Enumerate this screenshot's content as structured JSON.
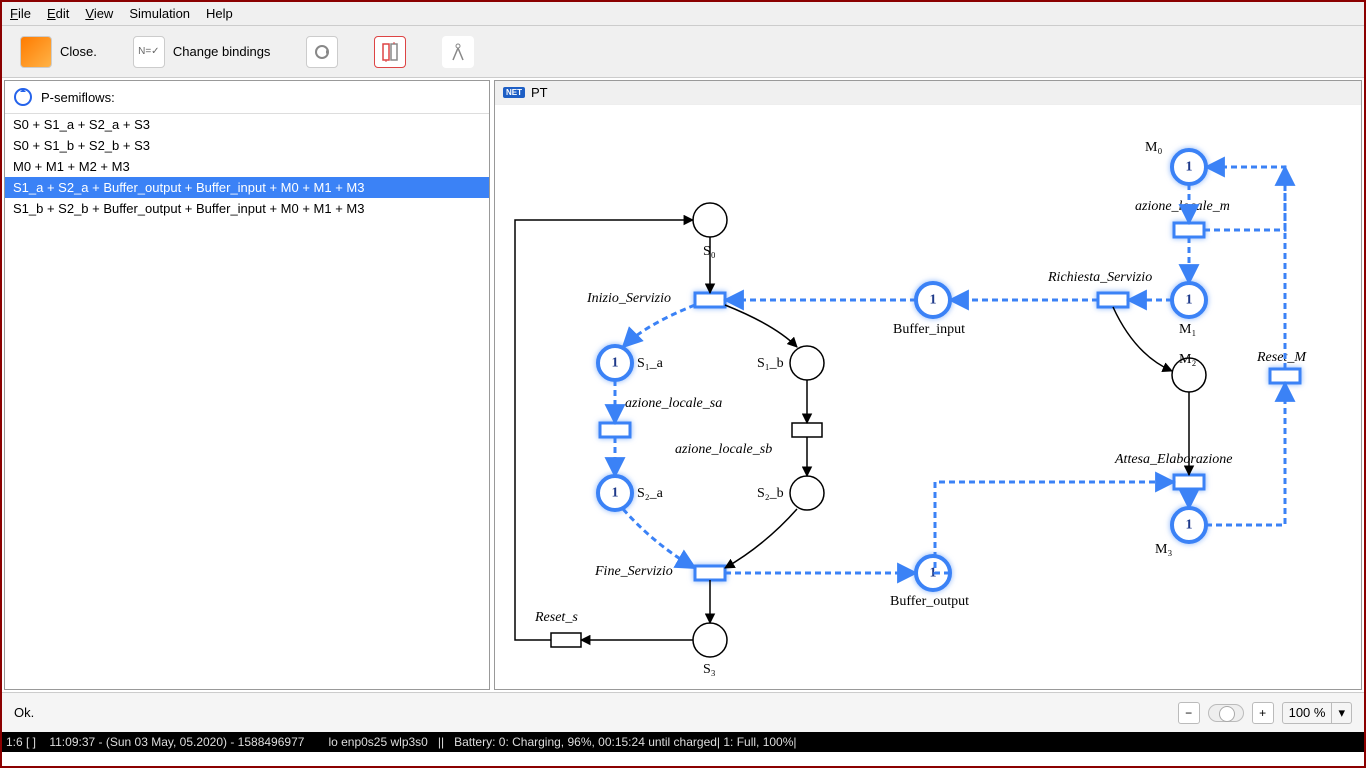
{
  "menu": {
    "file": "File",
    "edit": "Edit",
    "view": "View",
    "simulation": "Simulation",
    "help": "Help"
  },
  "toolbar": {
    "close": "Close.",
    "change_bindings": "Change bindings"
  },
  "left_panel": {
    "title": "P-semiflows:",
    "items": [
      "S0 + S1_a + S2_a + S3",
      "S0 + S1_b + S2_b + S3",
      "M0 + M1 + M2 + M3",
      "S1_a + S2_a + Buffer_output + Buffer_input + M0 + M1 + M3",
      "S1_b + S2_b + Buffer_output + Buffer_input + M0 + M1 + M3"
    ],
    "selected_index": 3
  },
  "net": {
    "title": "PT",
    "places": {
      "S0": {
        "label": "S₀",
        "hl": false
      },
      "S1_a": {
        "label": "S₁_a",
        "hl": true,
        "token": "1"
      },
      "S1_b": {
        "label": "S₁_b",
        "hl": false
      },
      "S2_a": {
        "label": "S₂_a",
        "hl": true,
        "token": "1"
      },
      "S2_b": {
        "label": "S₂_b",
        "hl": false
      },
      "S3": {
        "label": "S₃",
        "hl": false
      },
      "Buffer_input": {
        "label": "Buffer_input",
        "hl": true,
        "token": "1"
      },
      "Buffer_output": {
        "label": "Buffer_output",
        "hl": true,
        "token": "1"
      },
      "M0": {
        "label": "M₀",
        "hl": true,
        "token": "1"
      },
      "M1": {
        "label": "M₁",
        "hl": true,
        "token": "1"
      },
      "M2": {
        "label": "M₂",
        "hl": false
      },
      "M3": {
        "label": "M₃",
        "hl": true,
        "token": "1"
      }
    },
    "transitions": {
      "Inizio_Servizio": {
        "label": "Inizio_Servizio",
        "hl": true
      },
      "azione_locale_sa": {
        "label": "azione_locale_sa",
        "hl": true
      },
      "azione_locale_sb": {
        "label": "azione_locale_sb",
        "hl": false
      },
      "Fine_Servizio": {
        "label": "Fine_Servizio",
        "hl": true
      },
      "Reset_s": {
        "label": "Reset_s",
        "hl": false
      },
      "azione_locale_m": {
        "label": "azione_locale_m",
        "hl": true
      },
      "Richiesta_Servizio": {
        "label": "Richiesta_Servizio",
        "hl": true
      },
      "Attesa_Elaborazione": {
        "label": "Attesa_Elaborazione",
        "hl": true
      },
      "Reset_M": {
        "label": "Reset_M",
        "hl": true
      }
    }
  },
  "status": {
    "text": "Ok."
  },
  "zoom": {
    "value": "100 %"
  },
  "bottom": {
    "left": "1:6 [ ]    11:09:37 - (Sun 03 May, 05.2020) - 1588496977",
    "mid": "lo enp0s25 wlp3s0   ||   Battery: 0: Charging, 96%, 00:15:24 until charged| 1: Full, 100%|"
  }
}
